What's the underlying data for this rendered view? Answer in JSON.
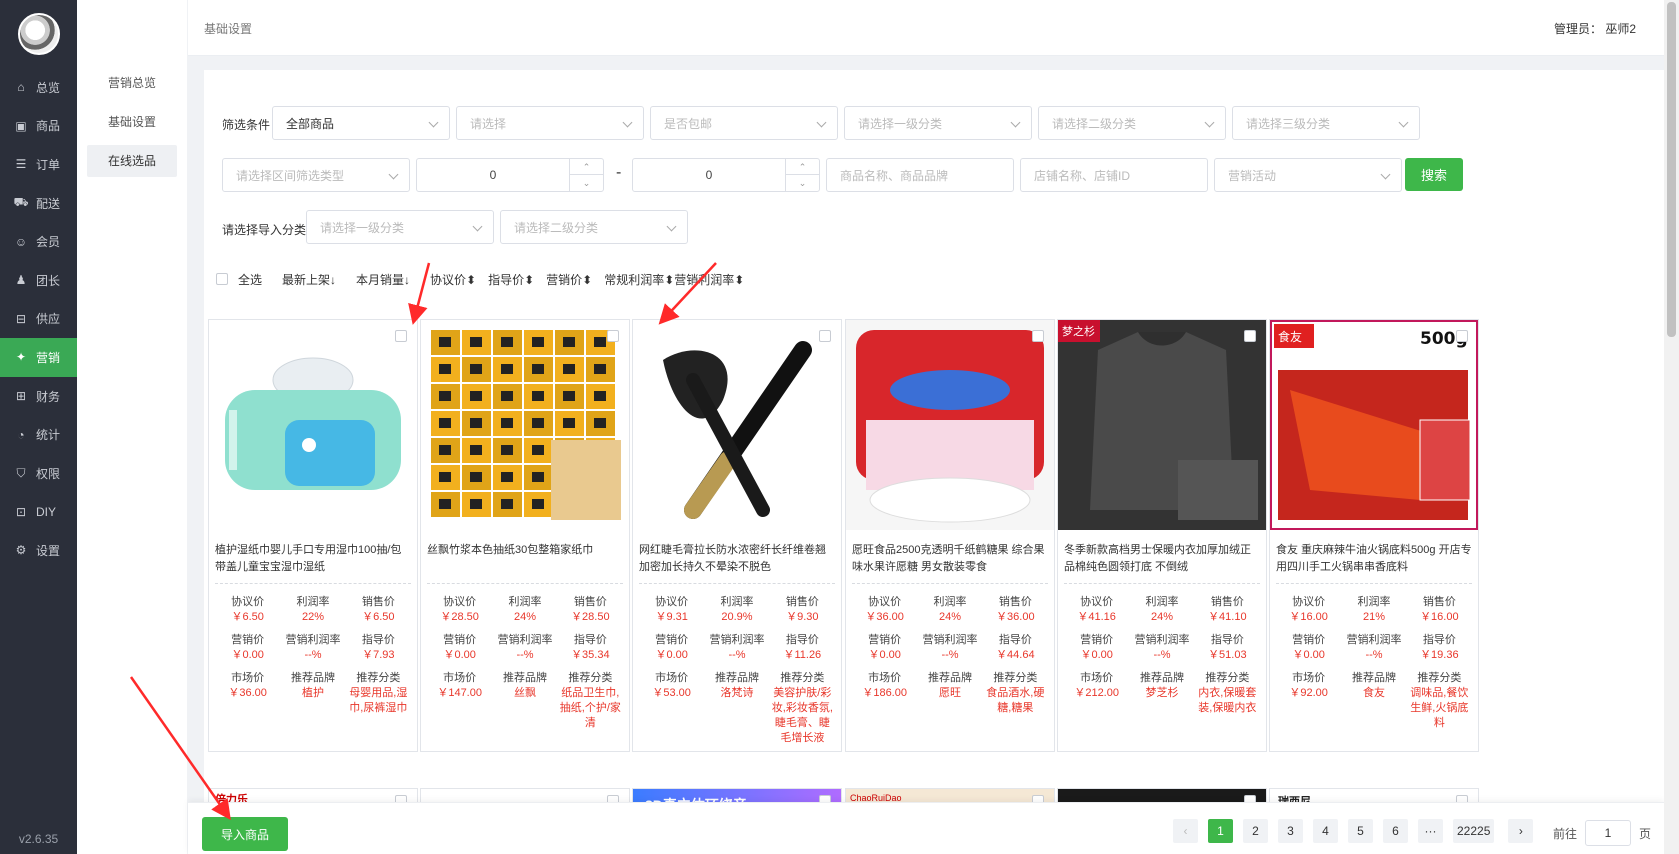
{
  "sidebar": {
    "items": [
      {
        "label": "总览",
        "icon": "home-icon"
      },
      {
        "label": "商品",
        "icon": "shop-icon"
      },
      {
        "label": "订单",
        "icon": "order-icon"
      },
      {
        "label": "配送",
        "icon": "truck-icon"
      },
      {
        "label": "会员",
        "icon": "user-icon"
      },
      {
        "label": "团长",
        "icon": "leader-icon"
      },
      {
        "label": "供应",
        "icon": "supply-icon"
      },
      {
        "label": "营销",
        "icon": "gift-icon",
        "active": true
      },
      {
        "label": "财务",
        "icon": "finance-icon"
      },
      {
        "label": "统计",
        "icon": "chart-icon"
      },
      {
        "label": "权限",
        "icon": "shield-icon"
      },
      {
        "label": "DIY",
        "icon": "layout-icon"
      },
      {
        "label": "设置",
        "icon": "gear-icon"
      }
    ],
    "version": "v2.6.35"
  },
  "submenu": {
    "items": [
      {
        "label": "营销总览"
      },
      {
        "label": "基础设置"
      },
      {
        "label": "在线选品",
        "active": true
      }
    ]
  },
  "header": {
    "breadcrumb": "基础设置",
    "admin": "管理员：   巫师2"
  },
  "filters": {
    "label": "筛选条件",
    "goods_scope": "全部商品",
    "select1_placeholder": "请选择",
    "shipping_placeholder": "是否包邮",
    "cat1_placeholder": "请选择一级分类",
    "cat2_placeholder": "请选择二级分类",
    "cat3_placeholder": "请选择三级分类",
    "range_type_placeholder": "请选择区间筛选类型",
    "min_value": "0",
    "range_sep": "-",
    "max_value": "0",
    "keyword_placeholder": "商品名称、商品品牌",
    "shop_placeholder": "店铺名称、店铺ID",
    "activity_placeholder": "营销活动",
    "search_label": "搜索",
    "import_label": "请选择导入分类",
    "import_cat1_placeholder": "请选择一级分类",
    "import_cat2_placeholder": "请选择二级分类"
  },
  "sortbar": {
    "select_all": "全选",
    "items": [
      "最新上架↓",
      "本月销量↓",
      "协议价⬍",
      "指导价⬍",
      "营销价⬍",
      "常规利润率⬍",
      "营销利润率⬍"
    ]
  },
  "labels": {
    "agreement": "协议价",
    "profit_rate": "利润率",
    "sale": "销售价",
    "marketing": "营销价",
    "mkt_rate": "营销利润率",
    "guide": "指导价",
    "market": "市场价",
    "brand": "推荐品牌",
    "category": "推荐分类"
  },
  "products": [
    {
      "title": "植护湿纸巾婴儿手口专用湿巾100抽/包带盖儿童宝宝湿巾湿纸",
      "agreement": "￥6.50",
      "rate": "22%",
      "sale": "￥6.50",
      "marketing": "￥0.00",
      "mkt_rate": "--%",
      "guide": "￥7.93",
      "market": "￥36.00",
      "brand": "植护",
      "category": "母婴用品,湿巾,尿裤湿巾"
    },
    {
      "title": "丝飘竹浆本色抽纸30包整箱家纸巾",
      "agreement": "￥28.50",
      "rate": "24%",
      "sale": "￥28.50",
      "marketing": "￥0.00",
      "mkt_rate": "--%",
      "guide": "￥35.34",
      "market": "￥147.00",
      "brand": "丝飘",
      "category": "纸品卫生巾,抽纸,个护/家清"
    },
    {
      "title": "网红睫毛膏拉长防水浓密纤长纤维卷翘加密加长持久不晕染不脱色",
      "agreement": "￥9.31",
      "rate": "20.9%",
      "sale": "￥9.30",
      "marketing": "￥0.00",
      "mkt_rate": "--%",
      "guide": "￥11.26",
      "market": "￥53.00",
      "brand": "洛梵诗",
      "category": "美容护肤/彩妆,彩妆香氛,睫毛膏、睫毛增长液"
    },
    {
      "title": "愿旺食品2500克透明千纸鹤糖果 综合果味水果许愿糖 男女散装零食",
      "agreement": "￥36.00",
      "rate": "24%",
      "sale": "￥36.00",
      "marketing": "￥0.00",
      "mkt_rate": "--%",
      "guide": "￥44.64",
      "market": "￥186.00",
      "brand": "愿旺",
      "category": "食品酒水,硬糖,糖果"
    },
    {
      "title": "冬季新款高档男士保暖内衣加厚加绒正品棉纯色圆领打底 不倒绒",
      "agreement": "￥41.16",
      "rate": "24%",
      "sale": "￥41.10",
      "marketing": "￥0.00",
      "mkt_rate": "--%",
      "guide": "￥51.03",
      "market": "￥212.00",
      "brand": "梦芝杉",
      "category": "内衣,保暖套装,保暖内衣"
    },
    {
      "title": "食友 重庆麻辣牛油火锅底料500g 开店专用四川手工火锅串串香底料",
      "agreement": "￥16.00",
      "rate": "21%",
      "sale": "￥16.00",
      "marketing": "￥0.00",
      "mkt_rate": "--%",
      "guide": "￥19.36",
      "market": "￥92.00",
      "brand": "食友",
      "category": "调味品,餐饮生鲜,火锅底料"
    }
  ],
  "product_badges": {
    "brand4": "梦之杉",
    "weight5": "500g",
    "logo5": "食友"
  },
  "second_row_badges": [
    "倍力乐",
    "",
    "8D真立体环绕音",
    "ChaoRuiDao",
    "",
    "瑞西尼"
  ],
  "bottom": {
    "import_button": "导入商品",
    "pages": [
      "1",
      "2",
      "3",
      "4",
      "5",
      "6",
      "···",
      "22225"
    ],
    "prev": "‹",
    "next": "›",
    "goto_prefix": "前往",
    "goto_value": "1",
    "goto_suffix": "页"
  },
  "colors": {
    "accent": "#3eb74a",
    "sidebar_bg": "#2b2f3a",
    "price_red": "#e8372b"
  }
}
